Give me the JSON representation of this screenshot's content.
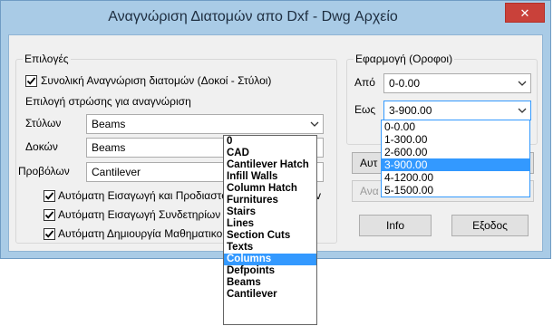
{
  "window": {
    "title": "Αναγνώριση Διατομών απο Dxf - Dwg Αρχείο",
    "close_glyph": "✕"
  },
  "options": {
    "legend": "Επιλογές",
    "total_recognition": {
      "label": "Συνολική Αναγνώριση διατομών (Δοκοί - Στύλοι)",
      "checked": true
    },
    "layer_selection_label": "Επιλογή στρώσης για αναγνώριση",
    "columns_label": "Στύλων",
    "columns_value": "Beams",
    "beams_label": "Δοκών",
    "beams_value": "Beams",
    "cantilevers_label": "Προβόλων",
    "cantilevers_value": "Cantilever",
    "auto_insert": {
      "label": "Αυτόματη Εισαγωγή και Προδιαστολ",
      "suffix": "v",
      "checked": true
    },
    "auto_stirrups": {
      "label": "Αυτόματη Εισαγωγή Συνδετηρίων",
      "checked": true
    },
    "auto_model": {
      "label": "Αυτόματη Δημιουργία Μαθηματικο",
      "checked": true
    }
  },
  "layer_dropdown": {
    "items": [
      "0",
      "CAD",
      "Cantilever Hatch",
      "Infill Walls",
      "Column Hatch",
      "Furnitures",
      "Stairs",
      "Lines",
      "Section Cuts",
      "Texts",
      "Columns",
      "Defpoints",
      "Beams",
      "Cantilever"
    ],
    "selected_index": 10
  },
  "floors": {
    "legend": "Εφαρμογή (Οροφοι)",
    "from_label": "Από",
    "from_value": "0-0.00",
    "to_label": "Εως",
    "to_value": "3-900.00",
    "items": [
      "0-0.00",
      "1-300.00",
      "2-600.00",
      "3-900.00",
      "4-1200.00",
      "5-1500.00"
    ],
    "selected_index": 3
  },
  "buttons": {
    "auto_partial": "Αυτ",
    "recognize_partial": "Ανα",
    "info": "Info",
    "exit": "Εξοδος"
  }
}
